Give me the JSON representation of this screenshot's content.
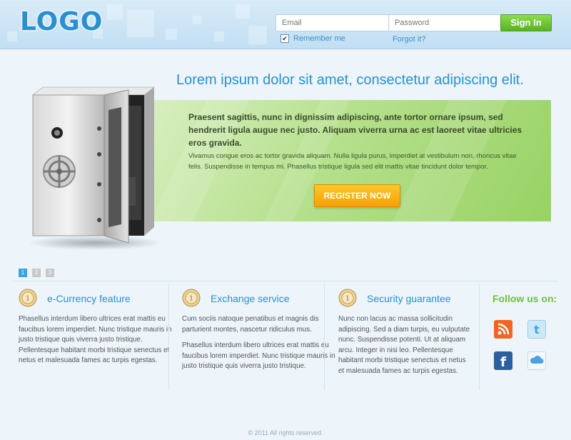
{
  "header": {
    "logo": "LOGO",
    "email_placeholder": "Email",
    "password_placeholder": "Password",
    "signin_label": "Sign In",
    "remember_label": "Remember me",
    "remember_checked": true,
    "forgot_label": "Forgot it?"
  },
  "hero": {
    "title": "Lorem ipsum dolor sit amet, consectetur adipiscing elit.",
    "lead": "Praesent sagittis, nunc in dignissim adipiscing, ante tortor ornare ipsum, sed hendrerit ligula augue nec justo. Aliquam viverra urna ac est laoreet vitae ultricies eros gravida.",
    "body": "Vivamus congue eros ac tortor gravida aliquam. Nulla ligula purus, imperdiet at vestibulum non, rhoncus vitae felis. Suspendisse in tempus mi. Phasellus tristique ligula sed elit mattis vitae tincidunt dolor tempor.",
    "register_label": "REGISTER NOW"
  },
  "slider": {
    "pages": [
      "1",
      "2",
      "3"
    ],
    "active": 1
  },
  "features": [
    {
      "title": "e-Currency feature",
      "paragraphs": [
        "Phasellus interdum libero ultrices erat mattis eu faucibus lorem imperdiet. Nunc tristique mauris in justo tristique quis viverra justo tristique.\nPellentesque habitant morbi tristique senectus et netus et malesuada fames ac turpis egestas."
      ]
    },
    {
      "title": "Exchange service",
      "paragraphs": [
        "Cum sociis natoque penatibus et magnis dis parturient montes, nascetur ridiculus mus.",
        "Phasellus interdum libero ultrices erat mattis eu faucibus lorem imperdiet. Nunc tristique mauris in justo tristique quis viverra justo tristique."
      ]
    },
    {
      "title": "Security guarantee",
      "paragraphs": [
        "Nunc non lacus ac massa sollicitudin adipiscing. Sed a diam turpis, eu vulputate nunc. Suspendisse potenti. Ut at aliquam arcu. Integer in nisi leo. Pellentesque habitant morbi tristique senectus et netus et malesuada fames ac turpis egestas."
      ]
    }
  ],
  "social": {
    "title": "Follow us on:",
    "items": [
      {
        "icon": "rss-icon",
        "color": "#f26522"
      },
      {
        "icon": "twitter-icon",
        "color": "#5bb7e8"
      },
      {
        "icon": "facebook-icon",
        "color": "#2d5f9e"
      },
      {
        "icon": "cloud-icon",
        "color": "#4aa3df"
      }
    ]
  },
  "footer": {
    "copyright": "© 2011  All rights reserved."
  },
  "colors": {
    "accent": "#2a8fcf",
    "green": "#6fbf3a",
    "orange": "#f7a007"
  }
}
